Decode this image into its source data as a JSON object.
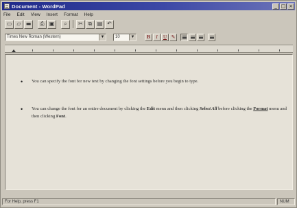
{
  "window": {
    "title": "Document - WordPad",
    "controls": [
      "_",
      "□",
      "×"
    ]
  },
  "menu": [
    "File",
    "Edit",
    "View",
    "Insert",
    "Format",
    "Help"
  ],
  "toolbar": {
    "icons": [
      "new-icon",
      "open-icon",
      "save-icon",
      "print-icon",
      "print-preview-icon",
      "find-icon",
      "cut-icon",
      "copy-icon",
      "paste-icon",
      "undo-icon"
    ],
    "glyphs": [
      "▭",
      "▱",
      "▬",
      "⎙",
      "▣",
      "⌕",
      "✂",
      "⧉",
      "▤",
      "↶"
    ]
  },
  "format": {
    "font_name": "Times New Roman (Western)",
    "font_size": "10",
    "bold": "B",
    "italic": "I",
    "underline": "U",
    "color": "✎"
  },
  "document": {
    "paragraph1": "You can specify the font for new text by changing the font settings before you begin to type.",
    "p2_a": "You can change the font for an entire document by clicking the ",
    "p2_edit": "Edit",
    "p2_b": " menu and then clicking ",
    "p2_selectall": "Select All",
    "p2_c": " before clicking the ",
    "p2_format": "Format",
    "p2_d": " menu and then clicking ",
    "p2_font": "Font",
    "p2_e": "."
  },
  "status": {
    "help_text": "For Help, press F1",
    "num": "NUM"
  }
}
